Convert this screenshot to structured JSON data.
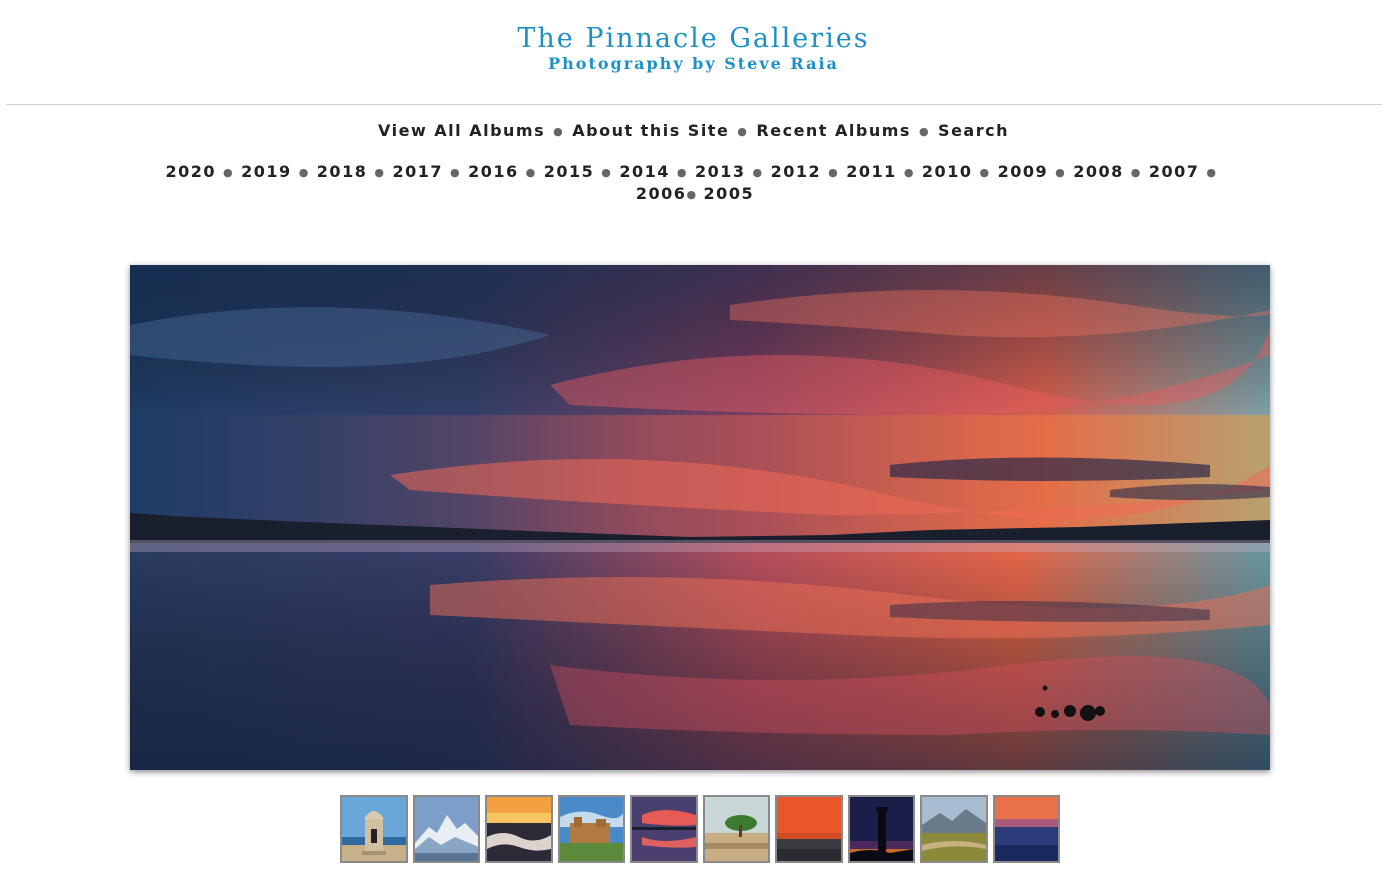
{
  "header": {
    "title": "The Pinnacle Galleries",
    "subtitle": "Photography by Steve Raia"
  },
  "main_nav": {
    "items": [
      "View All Albums",
      "About this Site",
      "Recent Albums",
      "Search"
    ]
  },
  "year_nav": {
    "years": [
      "2020",
      "2019",
      "2018",
      "2017",
      "2016",
      "2015",
      "2014",
      "2013",
      "2012",
      "2011",
      "2010",
      "2009",
      "2008",
      "2007",
      "2006",
      "2005"
    ]
  },
  "colors": {
    "brand": "#1e90c8",
    "text": "#222222",
    "divider": "#cfcfcf"
  },
  "hero": {
    "icon": "sunset-lake-photo"
  },
  "thumbnails": [
    {
      "icon": "sentry-box-photo"
    },
    {
      "icon": "snowy-mountains-photo"
    },
    {
      "icon": "clouds-sunrise-photo"
    },
    {
      "icon": "castle-ruins-photo"
    },
    {
      "icon": "sunset-reflection-photo"
    },
    {
      "icon": "beach-tree-photo"
    },
    {
      "icon": "orange-sunset-photo"
    },
    {
      "icon": "lighthouse-night-photo"
    },
    {
      "icon": "mountain-meadow-photo"
    },
    {
      "icon": "dusk-horizon-photo"
    }
  ]
}
